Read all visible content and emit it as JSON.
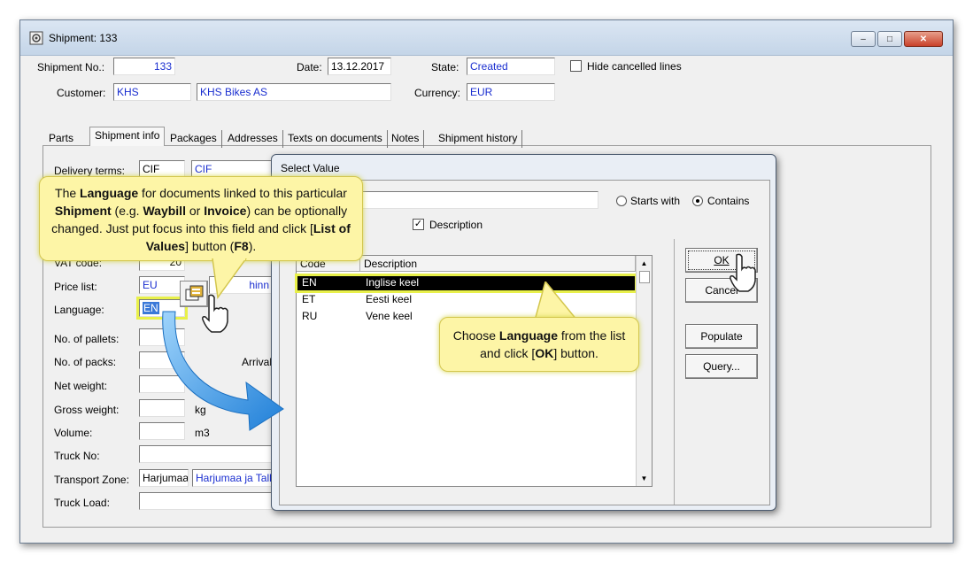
{
  "window": {
    "title": "Shipment: 133",
    "controls": {
      "minimize": "–",
      "maximize": "□",
      "close": "✕"
    }
  },
  "header": {
    "shipment_no_label": "Shipment No.:",
    "shipment_no": "133",
    "date_label": "Date:",
    "date": "13.12.2017",
    "state_label": "State:",
    "state": "Created",
    "hide_cancelled_label": "Hide cancelled lines",
    "hide_cancelled_checked": false,
    "customer_label": "Customer:",
    "customer_code": "KHS",
    "customer_name": "KHS Bikes AS",
    "currency_label": "Currency:",
    "currency": "EUR"
  },
  "tabs": [
    "Parts",
    "Shipment info",
    "Packages",
    "Addresses",
    "Texts on documents",
    "Notes",
    "Shipment history"
  ],
  "active_tab": "Shipment info",
  "shipment_info": {
    "delivery_terms_label": "Delivery terms:",
    "delivery_terms_code": "CIF",
    "delivery_terms_name": "CIF",
    "vat_code_label": "VAT code:",
    "vat_code": "20",
    "price_list_label": "Price list:",
    "price_list_code": "EU",
    "price_list_name": "hinn",
    "language_label": "Language:",
    "language": "EN",
    "pallets_label": "No. of pallets:",
    "packs_label": "No. of packs:",
    "arrival_label": "Arrival",
    "net_weight_label": "Net weight:",
    "gross_weight_label": "Gross weight:",
    "gross_weight_unit": "kg",
    "volume_label": "Volume:",
    "volume_unit": "m3",
    "truck_no_label": "Truck No:",
    "transport_zone_label": "Transport Zone:",
    "transport_zone_code": "Harjumaa",
    "transport_zone_name": "Harjumaa ja Talli",
    "truck_load_label": "Truck Load:"
  },
  "dialog": {
    "title": "Select Value",
    "search_value": "",
    "starts_with_label": "Starts with",
    "contains_label": "Contains",
    "match_mode": "contains",
    "description_label": "Description",
    "description_checked": true,
    "columns": {
      "code": "Code",
      "description": "Description"
    },
    "rows": [
      {
        "code": "EN",
        "description": "Inglise keel",
        "selected": true
      },
      {
        "code": "ET",
        "description": "Eesti keel",
        "selected": false
      },
      {
        "code": "RU",
        "description": "Vene keel",
        "selected": false
      }
    ],
    "buttons": {
      "ok": "OK",
      "cancel": "Cancel",
      "populate": "Populate",
      "query": "Query..."
    }
  },
  "callouts": {
    "language": {
      "p1": "The ",
      "b1": "Language",
      "p2": " for documents linked to this particular ",
      "b2": "Shipment",
      "p3": " (e.g. ",
      "b3": "Waybill",
      "p4": " or ",
      "b4": "Invoice",
      "p5": ") can be optionally changed.  Just put focus into this field and click [",
      "b5": "List of Values",
      "p6": "] button (",
      "b6": "F8",
      "p7": ")."
    },
    "choose": {
      "p1": "Choose ",
      "b1": "Language",
      "p2": " from the list and click [",
      "b2": "OK",
      "p3": "] button."
    }
  },
  "colors": {
    "callout_bg": "#fdf5a6",
    "highlight": "#e8f04a",
    "arrow": "#2f8fe0",
    "field_text_blue": "#1a2ed0"
  }
}
